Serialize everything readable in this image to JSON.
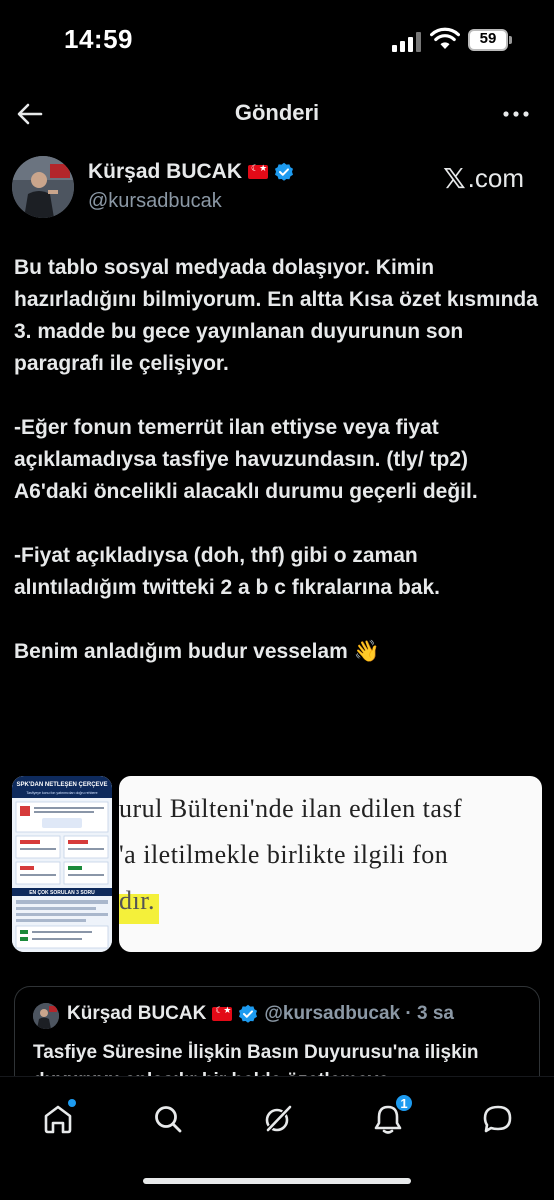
{
  "status_bar": {
    "time": "14:59",
    "battery": "59"
  },
  "header": {
    "title": "Gönderi"
  },
  "tweet": {
    "author_name": "Kürşad BUCAK",
    "handle": "@kursadbucak",
    "source_logo": "𝕏",
    "source_text": ".com",
    "paragraphs": [
      "Bu tablo sosyal medyada dolaşıyor. Kimin hazırladığını bilmiyorum. En altta Kısa özet kısmında 3. madde bu gece yayınlanan duyurunun son paragrafı ile çelişiyor.",
      "-Eğer fonun temerrüt ilan ettiyse veya fiyat açıklamadıysa tasfiye havuzundasın. (tly/ tp2)",
      "A6'daki öncelikli alacaklı durumu geçerli değil.",
      "-Fiyat açıkladıysa (doh, thf) gibi o zaman alıntıladığım twitteki 2 a b c fıkralarına bak.",
      "Benim anladığım budur vesselam 👋"
    ],
    "media": {
      "infographic_title": "SPK'DAN NETLEŞEN ÇERÇEVE",
      "infographic_subtitle": "Tasfiyeye konu fon yatırımcıları doğru rehbere",
      "infographic_faq": "EN ÇOK SORULAN 3 SORU",
      "doc_line_1": "urul Bülteni'nde ilan edilen tasf",
      "doc_line_2": "'a iletilmekle birlikte ilgili fon",
      "doc_line_3": "dır."
    }
  },
  "quote": {
    "author_name": "Kürşad BUCAK",
    "meta": "@kursadbucak · 3 sa",
    "text": "Tasfiye Süresine İlişkin Basın Duyurusu'na ilişkin duyuruyu anlaşılır bir halde özetlemeye"
  },
  "bottom_nav": {
    "notification_count": "1",
    "items": [
      "home-icon",
      "search-icon",
      "grok-icon",
      "notifications-icon",
      "messages-icon"
    ]
  },
  "colors": {
    "accent": "#1d9bf0",
    "background": "#000000",
    "text_primary": "#e7e9ea",
    "text_secondary": "#8b98a5"
  }
}
